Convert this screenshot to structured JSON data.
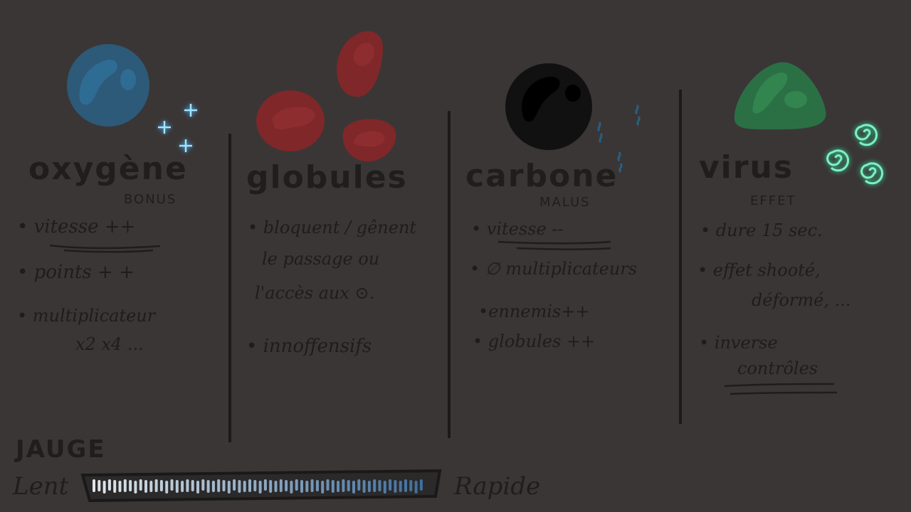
{
  "columns": [
    {
      "title": "oxygène",
      "tag": "BONUS",
      "items": [
        "• vitesse ++",
        "• points + +",
        "• multiplicateur",
        "x2 x4 ..."
      ],
      "color": "#2e5f80",
      "icon": "oxygen-bubble-icon"
    },
    {
      "title": "globules",
      "tag": "",
      "items": [
        "• bloquent / gênent",
        "le passage ou",
        "l'accès aux ⊙.",
        "• innoffensifs"
      ],
      "color": "#8a2a2c",
      "icon": "red-blood-cell-icon"
    },
    {
      "title": "carbone",
      "tag": "MALUS",
      "items": [
        "• vitesse --",
        "• ∅ multiplicateurs",
        "•ennemis++",
        "• globules ++"
      ],
      "color": "#121111",
      "icon": "carbon-ball-icon"
    },
    {
      "title": "virus",
      "tag": "EFFET",
      "items": [
        "• dure 15 sec.",
        "• effet shooté,",
        "déformé, ...",
        "• inverse",
        "contrôles"
      ],
      "color": "#2e7a4a",
      "icon": "virus-blob-icon"
    }
  ],
  "gauge": {
    "title": "JAUGE",
    "left_label": "Lent",
    "right_label": "Rapide",
    "colors": [
      "#e0e6ea",
      "#3e6f9e"
    ]
  }
}
